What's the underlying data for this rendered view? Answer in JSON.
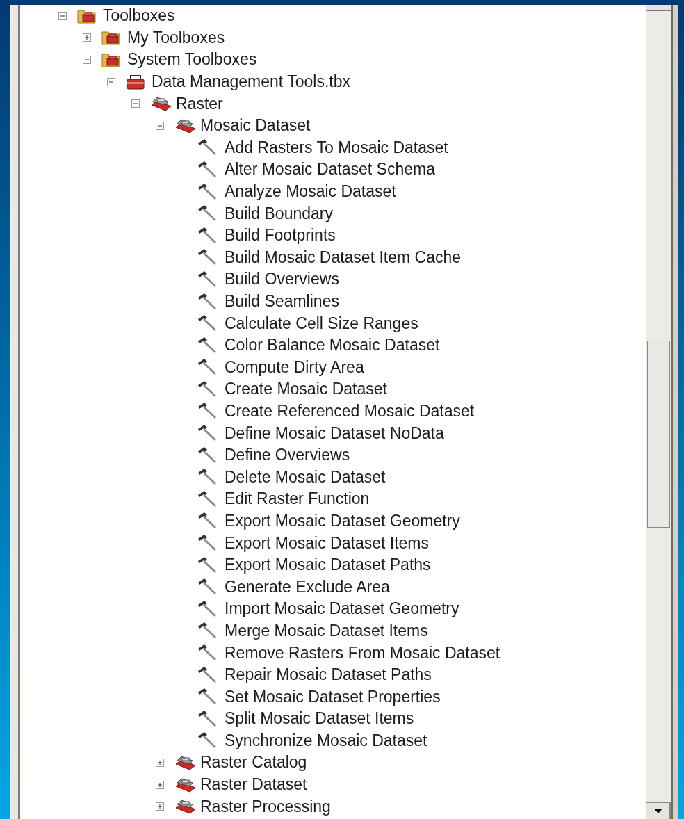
{
  "tree": [
    {
      "kind": "folder",
      "label": "Toolboxes",
      "expanded": true,
      "children": [
        {
          "kind": "folder",
          "label": "My Toolboxes",
          "expanded": false
        },
        {
          "kind": "folder",
          "label": "System Toolboxes",
          "expanded": true,
          "children": [
            {
              "kind": "toolbox",
              "label": "Data Management Tools.tbx",
              "expanded": true,
              "children": [
                {
                  "kind": "toolset",
                  "label": "Raster",
                  "expanded": true,
                  "children": [
                    {
                      "kind": "toolset",
                      "label": "Mosaic Dataset",
                      "expanded": true,
                      "children": [
                        {
                          "kind": "tool",
                          "label": "Add Rasters To Mosaic Dataset"
                        },
                        {
                          "kind": "tool",
                          "label": "Alter Mosaic Dataset Schema"
                        },
                        {
                          "kind": "tool",
                          "label": "Analyze Mosaic Dataset"
                        },
                        {
                          "kind": "tool",
                          "label": "Build Boundary"
                        },
                        {
                          "kind": "tool",
                          "label": "Build Footprints"
                        },
                        {
                          "kind": "tool",
                          "label": "Build Mosaic Dataset Item Cache"
                        },
                        {
                          "kind": "tool",
                          "label": "Build Overviews"
                        },
                        {
                          "kind": "tool",
                          "label": "Build Seamlines"
                        },
                        {
                          "kind": "tool",
                          "label": "Calculate Cell Size Ranges"
                        },
                        {
                          "kind": "tool",
                          "label": "Color Balance Mosaic Dataset"
                        },
                        {
                          "kind": "tool",
                          "label": "Compute Dirty Area"
                        },
                        {
                          "kind": "tool",
                          "label": "Create Mosaic Dataset"
                        },
                        {
                          "kind": "tool",
                          "label": "Create Referenced Mosaic Dataset"
                        },
                        {
                          "kind": "tool",
                          "label": "Define Mosaic Dataset NoData"
                        },
                        {
                          "kind": "tool",
                          "label": "Define Overviews"
                        },
                        {
                          "kind": "tool",
                          "label": "Delete Mosaic Dataset"
                        },
                        {
                          "kind": "tool",
                          "label": "Edit Raster Function"
                        },
                        {
                          "kind": "tool",
                          "label": "Export Mosaic Dataset Geometry"
                        },
                        {
                          "kind": "tool",
                          "label": "Export Mosaic Dataset Items"
                        },
                        {
                          "kind": "tool",
                          "label": "Export Mosaic Dataset Paths"
                        },
                        {
                          "kind": "tool",
                          "label": "Generate Exclude Area"
                        },
                        {
                          "kind": "tool",
                          "label": "Import Mosaic Dataset Geometry"
                        },
                        {
                          "kind": "tool",
                          "label": "Merge Mosaic Dataset Items"
                        },
                        {
                          "kind": "tool",
                          "label": "Remove Rasters From Mosaic Dataset"
                        },
                        {
                          "kind": "tool",
                          "label": "Repair Mosaic Dataset Paths"
                        },
                        {
                          "kind": "tool",
                          "label": "Set Mosaic Dataset Properties"
                        },
                        {
                          "kind": "tool",
                          "label": "Split Mosaic Dataset Items"
                        },
                        {
                          "kind": "tool",
                          "label": "Synchronize Mosaic Dataset"
                        }
                      ]
                    },
                    {
                      "kind": "toolset",
                      "label": "Raster Catalog",
                      "expanded": false
                    },
                    {
                      "kind": "toolset",
                      "label": "Raster Dataset",
                      "expanded": false
                    },
                    {
                      "kind": "toolset",
                      "label": "Raster Processing",
                      "expanded": false
                    }
                  ]
                }
              ]
            }
          ]
        }
      ]
    }
  ]
}
